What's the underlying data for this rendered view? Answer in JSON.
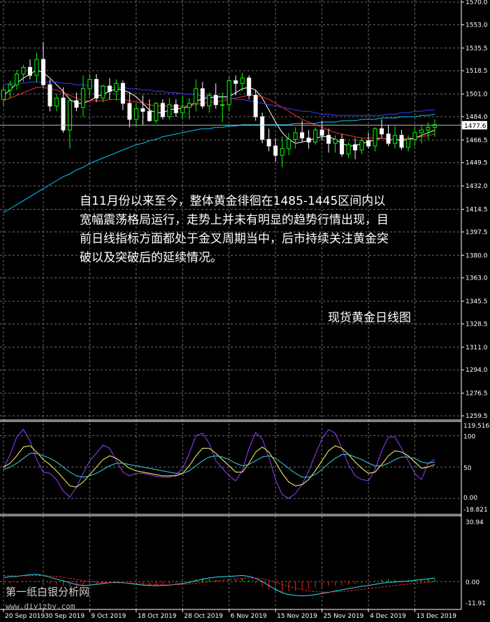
{
  "annotation": {
    "lines": [
      "自11月份以来至今，整体黄金徘徊在1485-1445区间内以",
      "宽幅震荡格局运行，走势上并未有明显的趋势行情出现，目",
      "前日线指标方面都处于金叉周期当中，后市持续关注黄金突",
      "破以及突破后的延续情况。"
    ],
    "chart_title": "现货黄金日线图"
  },
  "watermark": {
    "line1": "第一纸白银分析网",
    "line2": "www.diyizby.com"
  },
  "colors": {
    "background": "#000000",
    "grid": "#6e6e6e",
    "bull_candle": "#00ff00",
    "bear_candle": "#ffffff",
    "ma_fast": "#ffffff",
    "ma_mid": "#ff2a2a",
    "ma_slow": "#3a3aff",
    "ma_long": "#00c8ff",
    "kdj_j": "#9b3cff",
    "kdj_k": "#ffff66",
    "kdj_d": "#40d0e0",
    "macd_bar_neg": "#ff2020",
    "macd_bar_pos": "#00ff00",
    "macd_dif": "#30e0ff",
    "macd_dea": "#ff2020"
  },
  "chart_data": [
    {
      "type": "candlestick",
      "name": "main",
      "y_ticks": [
        "1570.0",
        "1553.0",
        "1535.5",
        "1518.5",
        "1501.0",
        "1484.0",
        "1466.5",
        "1449.5",
        "1432.0",
        "1414.5",
        "1397.5",
        "1380.0",
        "1363.0",
        "1345.5",
        "1328.5",
        "1311.0",
        "1294.0",
        "1276.5",
        "1259.5"
      ],
      "ylim": [
        1259.5,
        1570.0
      ],
      "current_price": "1477.6",
      "x_ticks": [
        "20 Sep 2019",
        "30 Sep 2019",
        "9 Oct 2019",
        "18 Oct 2019",
        "28 Oct 2019",
        "6 Nov 2019",
        "15 Nov 2019",
        "25 Nov 2019",
        "4 Dec 2019",
        "13 Dec 2019"
      ],
      "x_tick_index": [
        0,
        6,
        13,
        20,
        27,
        34,
        41,
        48,
        55,
        62
      ],
      "ohlc": [
        [
          1497,
          1507,
          1492,
          1504
        ],
        [
          1504,
          1511,
          1498,
          1508
        ],
        [
          1508,
          1519,
          1504,
          1516
        ],
        [
          1516,
          1523,
          1510,
          1521
        ],
        [
          1521,
          1527,
          1512,
          1515
        ],
        [
          1515,
          1532,
          1510,
          1527
        ],
        [
          1527,
          1540,
          1506,
          1508
        ],
        [
          1508,
          1512,
          1488,
          1492
        ],
        [
          1492,
          1501,
          1488,
          1498
        ],
        [
          1498,
          1506,
          1472,
          1474
        ],
        [
          1474,
          1498,
          1460,
          1496
        ],
        [
          1496,
          1502,
          1488,
          1491
        ],
        [
          1491,
          1515,
          1484,
          1505
        ],
        [
          1505,
          1516,
          1499,
          1512
        ],
        [
          1512,
          1516,
          1495,
          1498
        ],
        [
          1498,
          1508,
          1495,
          1507
        ],
        [
          1507,
          1513,
          1497,
          1503
        ],
        [
          1503,
          1512,
          1496,
          1509
        ],
        [
          1509,
          1511,
          1489,
          1494
        ],
        [
          1494,
          1502,
          1476,
          1482
        ],
        [
          1482,
          1494,
          1477,
          1490
        ],
        [
          1490,
          1500,
          1478,
          1488
        ],
        [
          1488,
          1497,
          1480,
          1481
        ],
        [
          1481,
          1495,
          1479,
          1494
        ],
        [
          1494,
          1497,
          1482,
          1484
        ],
        [
          1484,
          1498,
          1482,
          1493
        ],
        [
          1493,
          1497,
          1484,
          1487
        ],
        [
          1487,
          1500,
          1482,
          1491
        ],
        [
          1491,
          1498,
          1482,
          1494
        ],
        [
          1494,
          1512,
          1488,
          1505
        ],
        [
          1505,
          1510,
          1490,
          1492
        ],
        [
          1492,
          1502,
          1487,
          1500
        ],
        [
          1500,
          1509,
          1490,
          1493
        ],
        [
          1493,
          1502,
          1480,
          1493
        ],
        [
          1493,
          1514,
          1488,
          1511
        ],
        [
          1511,
          1515,
          1500,
          1509
        ],
        [
          1509,
          1517,
          1503,
          1513
        ],
        [
          1513,
          1515,
          1497,
          1500
        ],
        [
          1500,
          1504,
          1481,
          1484
        ],
        [
          1484,
          1487,
          1464,
          1467
        ],
        [
          1467,
          1475,
          1458,
          1462
        ],
        [
          1462,
          1468,
          1450,
          1455
        ],
        [
          1455,
          1469,
          1446,
          1460
        ],
        [
          1460,
          1472,
          1455,
          1467
        ],
        [
          1467,
          1476,
          1460,
          1472
        ],
        [
          1472,
          1481,
          1465,
          1468
        ],
        [
          1468,
          1474,
          1460,
          1465
        ],
        [
          1465,
          1476,
          1463,
          1474
        ],
        [
          1474,
          1481,
          1466,
          1470
        ],
        [
          1470,
          1475,
          1457,
          1464
        ],
        [
          1464,
          1470,
          1457,
          1467
        ],
        [
          1467,
          1471,
          1454,
          1456
        ],
        [
          1456,
          1465,
          1453,
          1463
        ],
        [
          1463,
          1468,
          1452,
          1459
        ],
        [
          1459,
          1468,
          1456,
          1466
        ],
        [
          1466,
          1472,
          1460,
          1462
        ],
        [
          1462,
          1476,
          1458,
          1475
        ],
        [
          1475,
          1482,
          1468,
          1471
        ],
        [
          1471,
          1478,
          1462,
          1464
        ],
        [
          1464,
          1477,
          1460,
          1470
        ],
        [
          1470,
          1474,
          1459,
          1461
        ],
        [
          1461,
          1470,
          1458,
          1467
        ],
        [
          1467,
          1476,
          1462,
          1472
        ],
        [
          1472,
          1478,
          1464,
          1474
        ],
        [
          1474,
          1480,
          1467,
          1476
        ],
        [
          1476,
          1482,
          1469,
          1478
        ]
      ],
      "series": [
        {
          "name": "",
          "values": [
            1500,
            1504,
            1509,
            1513,
            1516,
            1519,
            1517,
            1513,
            1508,
            1503,
            1497,
            1494,
            1494,
            1496,
            1499,
            1501,
            1503,
            1505,
            1504,
            1502,
            1499,
            1494,
            1489,
            1487,
            1487,
            1489,
            1490,
            1490,
            1492,
            1495,
            1498,
            1498,
            1499,
            1499,
            1499,
            1502,
            1505,
            1506,
            1504,
            1498,
            1489,
            1480,
            1472,
            1467,
            1464,
            1465,
            1466,
            1468,
            1469,
            1469,
            1467,
            1464,
            1462,
            1462,
            1464,
            1465,
            1467,
            1468,
            1467,
            1467,
            1466,
            1467,
            1468,
            1470,
            1472,
            1474
          ]
        },
        {
          "name": "",
          "values": [
            1496,
            1498,
            1500,
            1502,
            1504,
            1506,
            1506,
            1505,
            1504,
            1502,
            1500,
            1498,
            1496,
            1496,
            1496,
            1496,
            1497,
            1497,
            1497,
            1496,
            1495,
            1494,
            1493,
            1492,
            1492,
            1492,
            1492,
            1492,
            1492,
            1493,
            1494,
            1495,
            1495,
            1496,
            1497,
            1498,
            1499,
            1500,
            1500,
            1499,
            1497,
            1494,
            1491,
            1488,
            1485,
            1482,
            1480,
            1478,
            1476,
            1474,
            1472,
            1471,
            1470,
            1469,
            1468,
            1468,
            1468,
            1468,
            1467,
            1467,
            1467,
            1468,
            1468,
            1469,
            1470,
            1471
          ]
        },
        {
          "name": "",
          "values": [
            1508,
            1509,
            1509,
            1509,
            1510,
            1510,
            1510,
            1510,
            1510,
            1509,
            1509,
            1508,
            1508,
            1507,
            1507,
            1507,
            1506,
            1506,
            1506,
            1505,
            1505,
            1504,
            1504,
            1503,
            1503,
            1502,
            1502,
            1501,
            1501,
            1500,
            1500,
            1499,
            1499,
            1498,
            1498,
            1497,
            1497,
            1496,
            1495,
            1494,
            1493,
            1492,
            1491,
            1490,
            1489,
            1488,
            1488,
            1487,
            1486,
            1486,
            1485,
            1485,
            1485,
            1485,
            1485,
            1485,
            1485,
            1485,
            1486,
            1486,
            1487,
            1487,
            1488,
            1488,
            1489,
            1489
          ]
        },
        {
          "name": "",
          "values": [
            1412,
            1415,
            1418,
            1421,
            1424,
            1427,
            1430,
            1433,
            1436,
            1439,
            1441,
            1444,
            1446,
            1449,
            1451,
            1453,
            1455,
            1457,
            1459,
            1461,
            1463,
            1464,
            1466,
            1467,
            1469,
            1470,
            1471,
            1472,
            1473,
            1474,
            1475,
            1475,
            1476,
            1476,
            1477,
            1477,
            1478,
            1478,
            1478,
            1478,
            1478,
            1478,
            1478,
            1478,
            1479,
            1479,
            1479,
            1479,
            1480,
            1480,
            1480,
            1481,
            1481,
            1481,
            1482,
            1482,
            1482,
            1483,
            1483,
            1483,
            1484,
            1484,
            1484,
            1485,
            1485,
            1486
          ]
        }
      ]
    },
    {
      "type": "line",
      "name": "KDJ",
      "y_ticks": [
        "119.5166",
        "100",
        "50",
        "0.00",
        "-18.821"
      ],
      "ylim": [
        -18.821,
        119.5166
      ],
      "series": [
        {
          "name": "",
          "values": [
            48,
            70,
            98,
            110,
            92,
            62,
            42,
            40,
            30,
            12,
            2,
            18,
            40,
            60,
            72,
            85,
            80,
            60,
            42,
            36,
            40,
            40,
            38,
            35,
            34,
            34,
            38,
            48,
            72,
            100,
            104,
            88,
            60,
            48,
            36,
            28,
            44,
            80,
            105,
            95,
            66,
            30,
            6,
            0,
            8,
            22,
            44,
            70,
            95,
            110,
            104,
            80,
            54,
            36,
            30,
            28,
            46,
            76,
            98,
            98,
            80,
            60,
            40,
            30,
            56,
            62
          ]
        },
        {
          "name": "",
          "values": [
            50,
            56,
            68,
            82,
            84,
            74,
            62,
            54,
            44,
            32,
            20,
            18,
            26,
            38,
            50,
            62,
            68,
            64,
            56,
            48,
            44,
            42,
            40,
            38,
            36,
            36,
            36,
            40,
            52,
            68,
            80,
            80,
            72,
            62,
            52,
            42,
            42,
            56,
            74,
            82,
            74,
            58,
            40,
            26,
            20,
            22,
            30,
            44,
            60,
            76,
            84,
            80,
            70,
            58,
            48,
            40,
            42,
            54,
            68,
            76,
            74,
            68,
            58,
            48,
            50,
            54
          ]
        },
        {
          "name": "",
          "values": [
            46,
            50,
            56,
            64,
            72,
            72,
            68,
            64,
            58,
            50,
            42,
            36,
            34,
            36,
            40,
            46,
            52,
            56,
            56,
            54,
            52,
            50,
            48,
            46,
            44,
            42,
            40,
            40,
            44,
            52,
            60,
            66,
            68,
            66,
            62,
            56,
            52,
            54,
            60,
            66,
            68,
            64,
            56,
            48,
            40,
            34,
            34,
            38,
            46,
            56,
            64,
            70,
            70,
            66,
            62,
            56,
            52,
            52,
            56,
            62,
            66,
            66,
            64,
            58,
            56,
            58
          ]
        }
      ]
    },
    {
      "type": "bar",
      "name": "MACD",
      "y_ticks": [
        "30.94",
        "0.00",
        "-11.91"
      ],
      "ylim": [
        -11.91,
        30.94
      ],
      "histogram": [
        -1.0,
        -0.8,
        -0.5,
        -0.3,
        -0.2,
        0.1,
        -0.5,
        -1.0,
        -1.5,
        -2.0,
        -2.5,
        -3.0,
        -2.5,
        -2.0,
        -1.5,
        -1.0,
        -0.6,
        -0.4,
        -0.6,
        -1.0,
        -1.5,
        -2.0,
        -2.5,
        -2.0,
        -1.6,
        -1.2,
        -0.8,
        -0.5,
        0.2,
        1.0,
        1.6,
        1.2,
        0.6,
        0.2,
        0.6,
        1.0,
        1.4,
        0.6,
        -1.0,
        -2.5,
        -4.0,
        -5.0,
        -5.5,
        -5.0,
        -4.6,
        -4.0,
        -3.6,
        -3.2,
        -2.8,
        -2.2,
        -2.0,
        -1.8,
        -1.5,
        -1.2,
        -0.8,
        -0.5,
        0.3,
        1.0,
        1.2,
        0.8,
        0.5,
        0.6,
        0.8,
        1.0,
        1.2,
        1.3
      ],
      "series": [
        {
          "name": "",
          "values": [
            2.0,
            2.4,
            2.6,
            3.0,
            3.4,
            3.6,
            3.0,
            2.2,
            1.2,
            0.4,
            -0.6,
            -1.6,
            -2.0,
            -1.8,
            -1.4,
            -1.0,
            -0.6,
            -0.4,
            -0.6,
            -1.0,
            -1.4,
            -1.8,
            -2.0,
            -2.1,
            -2.0,
            -1.8,
            -1.4,
            -1.0,
            -0.4,
            0.4,
            1.2,
            1.8,
            2.2,
            2.4,
            2.6,
            2.8,
            3.0,
            2.6,
            1.6,
            0.0,
            -2.0,
            -4.0,
            -5.6,
            -6.6,
            -7.0,
            -7.2,
            -7.0,
            -6.6,
            -6.0,
            -5.4,
            -4.8,
            -4.2,
            -3.6,
            -3.0,
            -2.4,
            -2.0,
            -1.4,
            -0.8,
            -0.4,
            -0.2,
            0.0,
            0.2,
            0.6,
            1.0,
            1.4,
            1.8
          ]
        },
        {
          "name": "",
          "values": [
            3.0,
            2.9,
            2.8,
            2.8,
            2.9,
            3.0,
            3.0,
            2.8,
            2.5,
            2.1,
            1.6,
            1.0,
            0.4,
            0.0,
            -0.3,
            -0.5,
            -0.6,
            -0.6,
            -0.7,
            -0.8,
            -1.0,
            -1.2,
            -1.4,
            -1.6,
            -1.7,
            -1.7,
            -1.6,
            -1.5,
            -1.2,
            -0.9,
            -0.5,
            -0.1,
            0.3,
            0.7,
            1.0,
            1.3,
            1.6,
            1.8,
            1.8,
            1.4,
            0.6,
            -0.4,
            -1.4,
            -2.4,
            -3.3,
            -4.1,
            -4.7,
            -5.1,
            -5.3,
            -5.3,
            -5.2,
            -5.0,
            -4.7,
            -4.4,
            -4.0,
            -3.6,
            -3.2,
            -2.8,
            -2.4,
            -2.0,
            -1.6,
            -1.3,
            -1.0,
            -0.7,
            -0.4,
            -0.1
          ]
        }
      ]
    }
  ]
}
